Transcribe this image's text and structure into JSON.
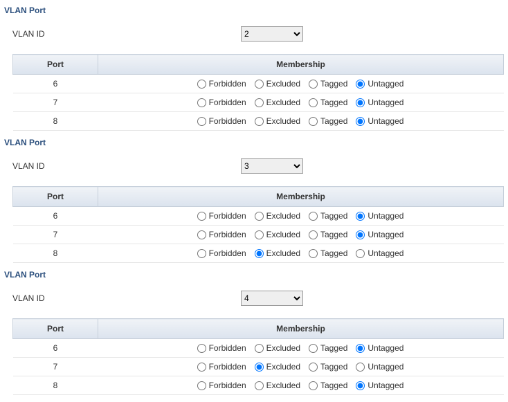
{
  "labels": {
    "section_title": "VLAN Port",
    "vlan_id_label": "VLAN ID",
    "col_port": "Port",
    "col_membership": "Membership",
    "opt_forbidden": "Forbidden",
    "opt_excluded": "Excluded",
    "opt_tagged": "Tagged",
    "opt_untagged": "Untagged"
  },
  "sections": [
    {
      "vlan_id": "2",
      "rows": [
        {
          "port": "6",
          "selected": "Untagged"
        },
        {
          "port": "7",
          "selected": "Untagged"
        },
        {
          "port": "8",
          "selected": "Untagged"
        }
      ]
    },
    {
      "vlan_id": "3",
      "rows": [
        {
          "port": "6",
          "selected": "Untagged"
        },
        {
          "port": "7",
          "selected": "Untagged"
        },
        {
          "port": "8",
          "selected": "Excluded"
        }
      ]
    },
    {
      "vlan_id": "4",
      "rows": [
        {
          "port": "6",
          "selected": "Untagged"
        },
        {
          "port": "7",
          "selected": "Excluded"
        },
        {
          "port": "8",
          "selected": "Untagged"
        }
      ]
    }
  ]
}
